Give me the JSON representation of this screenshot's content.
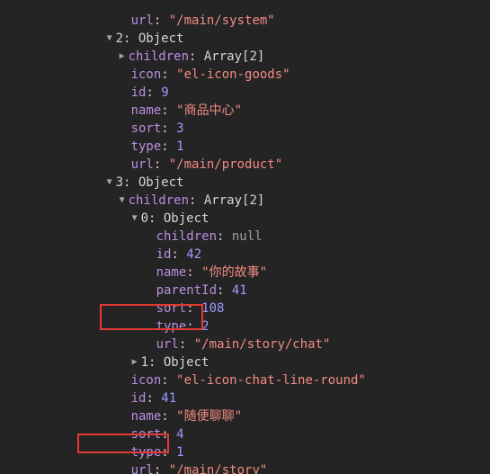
{
  "rows": [
    {
      "key": "url",
      "value": "\"/main/system\"",
      "vtype": "str"
    },
    {
      "key": "2",
      "value": "Object",
      "vtype": "obj",
      "expanded": true
    },
    {
      "key": "children",
      "value": "Array[2]",
      "vtype": "obj",
      "expanded": false
    },
    {
      "key": "icon",
      "value": "\"el-icon-goods\"",
      "vtype": "str"
    },
    {
      "key": "id",
      "value": "9",
      "vtype": "num"
    },
    {
      "key": "name",
      "value": "\"商品中心\"",
      "vtype": "str"
    },
    {
      "key": "sort",
      "value": "3",
      "vtype": "num"
    },
    {
      "key": "type",
      "value": "1",
      "vtype": "num"
    },
    {
      "key": "url",
      "value": "\"/main/product\"",
      "vtype": "str"
    },
    {
      "key": "3",
      "value": "Object",
      "vtype": "obj",
      "expanded": true
    },
    {
      "key": "children",
      "value": "Array[2]",
      "vtype": "obj",
      "expanded": true
    },
    {
      "key": "0",
      "value": "Object",
      "vtype": "obj",
      "expanded": true
    },
    {
      "key": "children",
      "value": "null",
      "vtype": "null"
    },
    {
      "key": "id",
      "value": "42",
      "vtype": "num"
    },
    {
      "key": "name",
      "value": "\"你的故事\"",
      "vtype": "str"
    },
    {
      "key": "parentId",
      "value": "41",
      "vtype": "num"
    },
    {
      "key": "sort",
      "value": "108",
      "vtype": "num"
    },
    {
      "key": "type",
      "value": "2",
      "vtype": "num",
      "highlighted": true
    },
    {
      "key": "url",
      "value": "\"/main/story/chat\"",
      "vtype": "str"
    },
    {
      "key": "1",
      "value": "Object",
      "vtype": "obj",
      "expanded": false
    },
    {
      "key": "icon",
      "value": "\"el-icon-chat-line-round\"",
      "vtype": "str"
    },
    {
      "key": "id",
      "value": "41",
      "vtype": "num"
    },
    {
      "key": "name",
      "value": "\"随便聊聊\"",
      "vtype": "str"
    },
    {
      "key": "sort",
      "value": "4",
      "vtype": "num"
    },
    {
      "key": "type",
      "value": "1",
      "vtype": "num",
      "highlighted": true
    },
    {
      "key": "url",
      "value": "\"/main/story\"",
      "vtype": "str"
    }
  ],
  "colors": {
    "background": "#242424",
    "key": "#b98fe0",
    "string": "#f28b82",
    "number": "#9b9bff",
    "highlight_box": "#e53935"
  },
  "icons": {
    "expanded": "triangle-down-icon",
    "collapsed": "triangle-right-icon"
  }
}
